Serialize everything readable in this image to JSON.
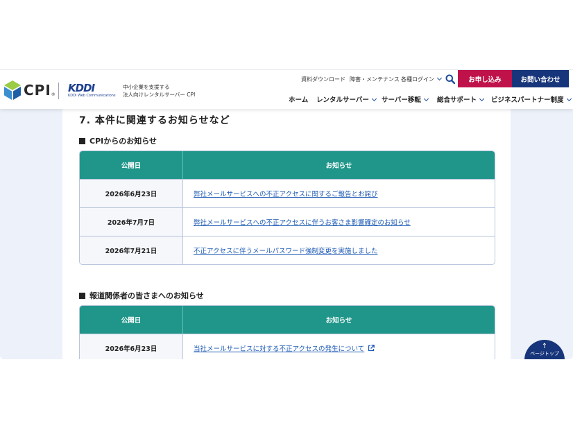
{
  "header": {
    "logo_text": "CPI",
    "logo_registered": "®",
    "kddi_mark": "KDDI",
    "kddi_sub": "KDDI Web Communications",
    "tagline_line1": "中小企業を支援する",
    "tagline_line2": "法人向けレンタルサーバー CPI",
    "utility_links": [
      "資料ダウンロード",
      "障害・メンテナンス",
      "各種ログイン"
    ],
    "apply_button": "お申し込み",
    "contact_button": "お問い合わせ",
    "nav": [
      "ホーム",
      "レンタルサーバー",
      "サーバー移転",
      "総合サポート",
      "ビジネスパートナー制度"
    ],
    "colors": {
      "apply": "#c0124a",
      "contact": "#17357a",
      "accent": "#1d4a9a"
    }
  },
  "main": {
    "section_title": "7. 本件に関連するお知らせなど",
    "cpi_notices": {
      "heading": "CPIからのお知らせ",
      "col_date": "公開日",
      "col_notice": "お知らせ",
      "rows": [
        {
          "date": "2026年6月23日",
          "title": "弊社メールサービスへの不正アクセスに関するご報告とお詫び"
        },
        {
          "date": "2026年7月7日",
          "title": "弊社メールサービスへの不正アクセスに伴うお客さま影響確定のお知らせ"
        },
        {
          "date": "2026年7月21日",
          "title": "不正アクセスに伴うメールパスワード強制変更を実施しました"
        }
      ]
    },
    "press_notices": {
      "heading": "報道関係者の皆さまへのお知らせ",
      "col_date": "公開日",
      "col_notice": "お知らせ",
      "rows": [
        {
          "date": "2026年6月23日",
          "title": "当社メールサービスに対する不正アクセスの発生について",
          "external": true
        }
      ]
    },
    "table_header_color": "#20968a"
  },
  "page_top": {
    "arrow": "↑",
    "label": "ページトップ"
  }
}
